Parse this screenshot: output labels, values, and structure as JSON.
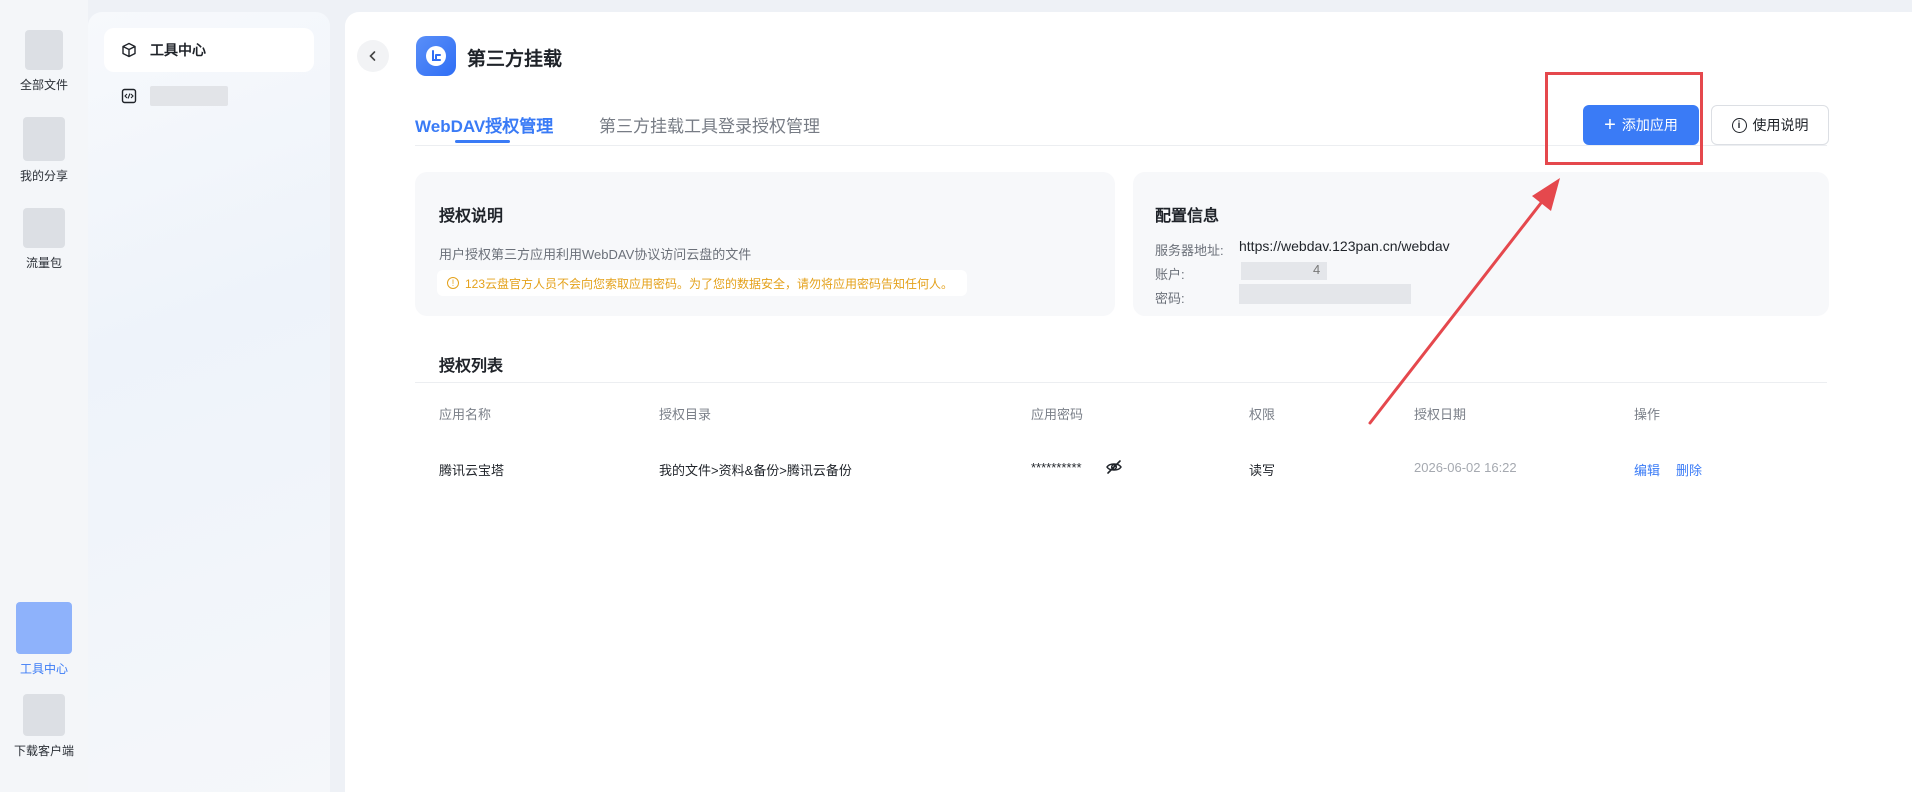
{
  "rail": {
    "items": [
      {
        "label": "全部文件"
      },
      {
        "label": "我的分享"
      },
      {
        "label": "流量包"
      },
      {
        "label": "工具中心"
      },
      {
        "label": "下载客户端"
      }
    ]
  },
  "sidebar": {
    "active_label": "工具中心"
  },
  "header": {
    "title": "第三方挂载"
  },
  "tabs": [
    {
      "label": "WebDAV授权管理",
      "active": true
    },
    {
      "label": "第三方挂载工具登录授权管理",
      "active": false
    }
  ],
  "actions": {
    "add_label": "添加应用",
    "help_label": "使用说明"
  },
  "auth_card": {
    "title": "授权说明",
    "desc": "用户授权第三方应用利用WebDAV协议访问云盘的文件",
    "warning": "123云盘官方人员不会向您索取应用密码。为了您的数据安全，请勿将应用密码告知任何人。"
  },
  "config_card": {
    "title": "配置信息",
    "server_label": "服务器地址:",
    "server_value": "https://webdav.123pan.cn/webdav",
    "account_label": "账户:",
    "account_tail": "4",
    "password_label": "密码:"
  },
  "list": {
    "title": "授权列表",
    "columns": [
      "应用名称",
      "授权目录",
      "应用密码",
      "权限",
      "授权日期",
      "操作"
    ],
    "rows": [
      {
        "app_name": "腾讯云宝塔",
        "directory": "我的文件>资料&备份>腾讯云备份",
        "password": "**********",
        "permission": "读写",
        "date": "2026-06-02 16:22",
        "edit": "编辑",
        "delete": "删除"
      }
    ]
  },
  "colors": {
    "accent": "#3a7bf6",
    "warning": "#e4a11b",
    "annotation": "#e5484d"
  }
}
